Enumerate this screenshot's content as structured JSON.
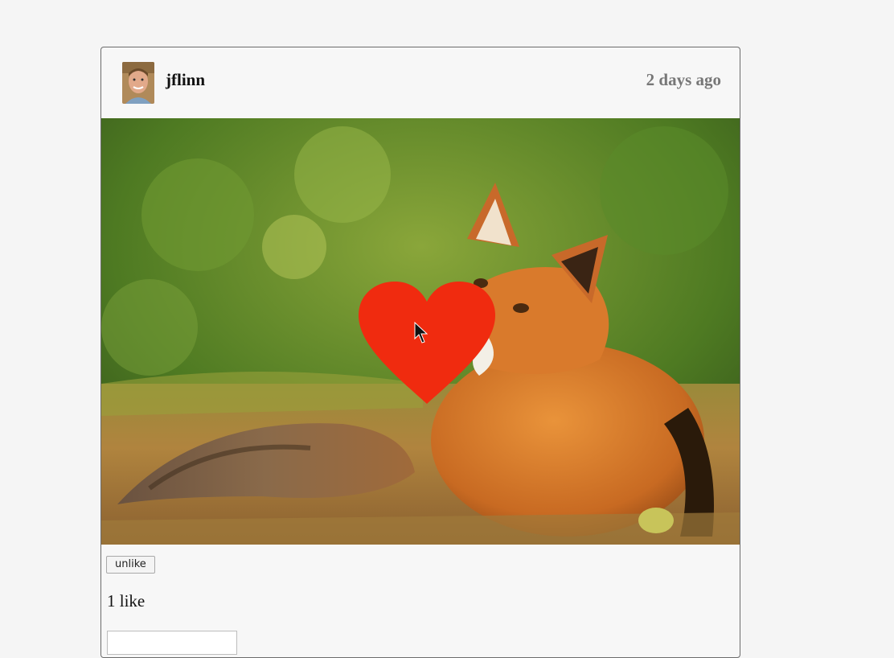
{
  "post": {
    "username": "jflinn",
    "timestamp": "2 days ago",
    "avatar_icon": "user-avatar",
    "photo_subject": "fox",
    "like_overlay_color": "#f02b0f",
    "like_button_label": "unlike",
    "like_count_text": "1 like",
    "comment_input_value": ""
  }
}
